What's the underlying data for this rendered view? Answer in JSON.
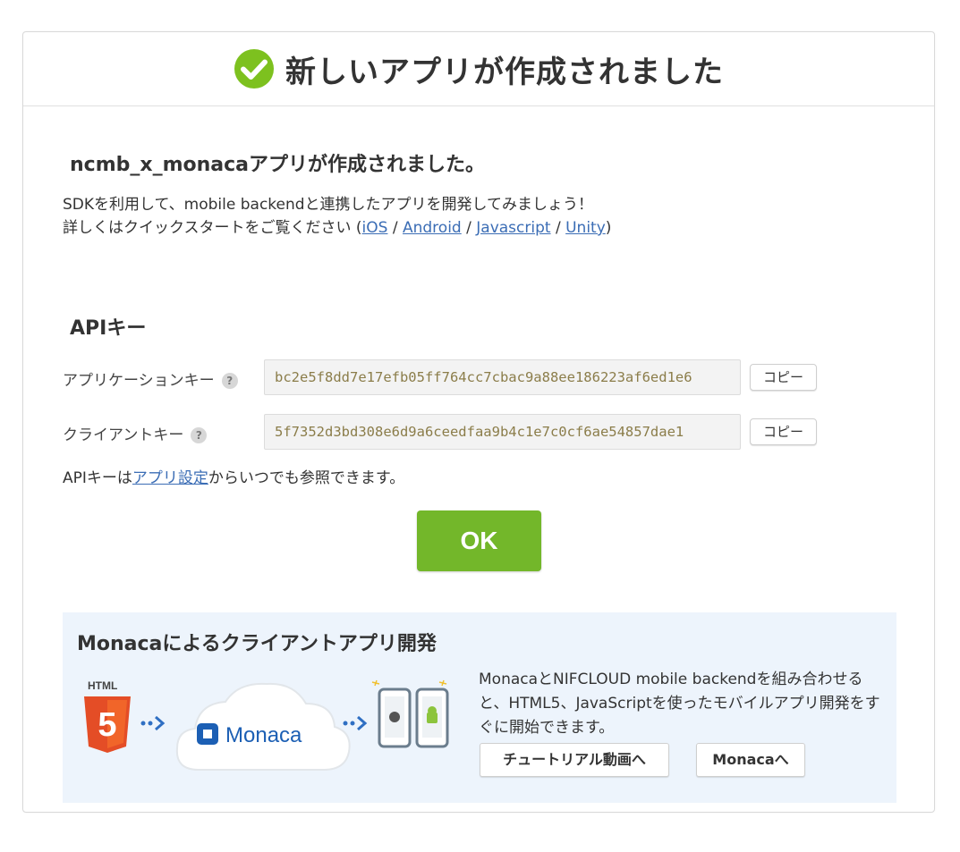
{
  "header": {
    "title": "新しいアプリが作成されました"
  },
  "intro": {
    "heading": "ncmb_x_monacaアプリが作成されました。",
    "line1": "SDKを利用して、mobile backendと連携したアプリを開発してみましょう！",
    "line2_prefix": "詳しくはクイックスタートをご覧ください (",
    "links": [
      "iOS",
      "Android",
      "Javascript",
      "Unity"
    ],
    "separator": " / ",
    "line2_suffix": ")"
  },
  "api": {
    "heading": "APIキー",
    "app_key_label": "アプリケーションキー",
    "app_key_value": "bc2e5f8dd7e17efb05ff764cc7cbac9a88ee186223af6ed1e6",
    "client_key_label": "クライアントキー",
    "client_key_value": "5f7352d3bd308e6d9a6ceedfaa9b4c1e7c0cf6ae54857dae1",
    "help_glyph": "?",
    "copy_label": "コピー",
    "note_prefix": "APIキーは",
    "note_link": "アプリ設定",
    "note_suffix": "からいつでも参照できます。"
  },
  "ok_button": "OK",
  "monaca": {
    "heading": "Monacaによるクライアントアプリ開発",
    "html_label": "HTML",
    "html_version": "5",
    "cloud_label": "Monaca",
    "description": "MonacaとNIFCLOUD mobile backendを組み合わせると、HTML5、JavaScriptを使ったモバイルアプリ開発をすぐに開始できます。",
    "tutorial_button": "チュートリアル動画へ",
    "monaca_button": "Monacaへ"
  },
  "colors": {
    "accent_green": "#73b72a",
    "check_green": "#7dc11f",
    "link_blue": "#3b6db5",
    "html5_orange": "#e44d26",
    "monaca_blue": "#1c5fb4",
    "arrow_blue": "#2f6fc3"
  }
}
